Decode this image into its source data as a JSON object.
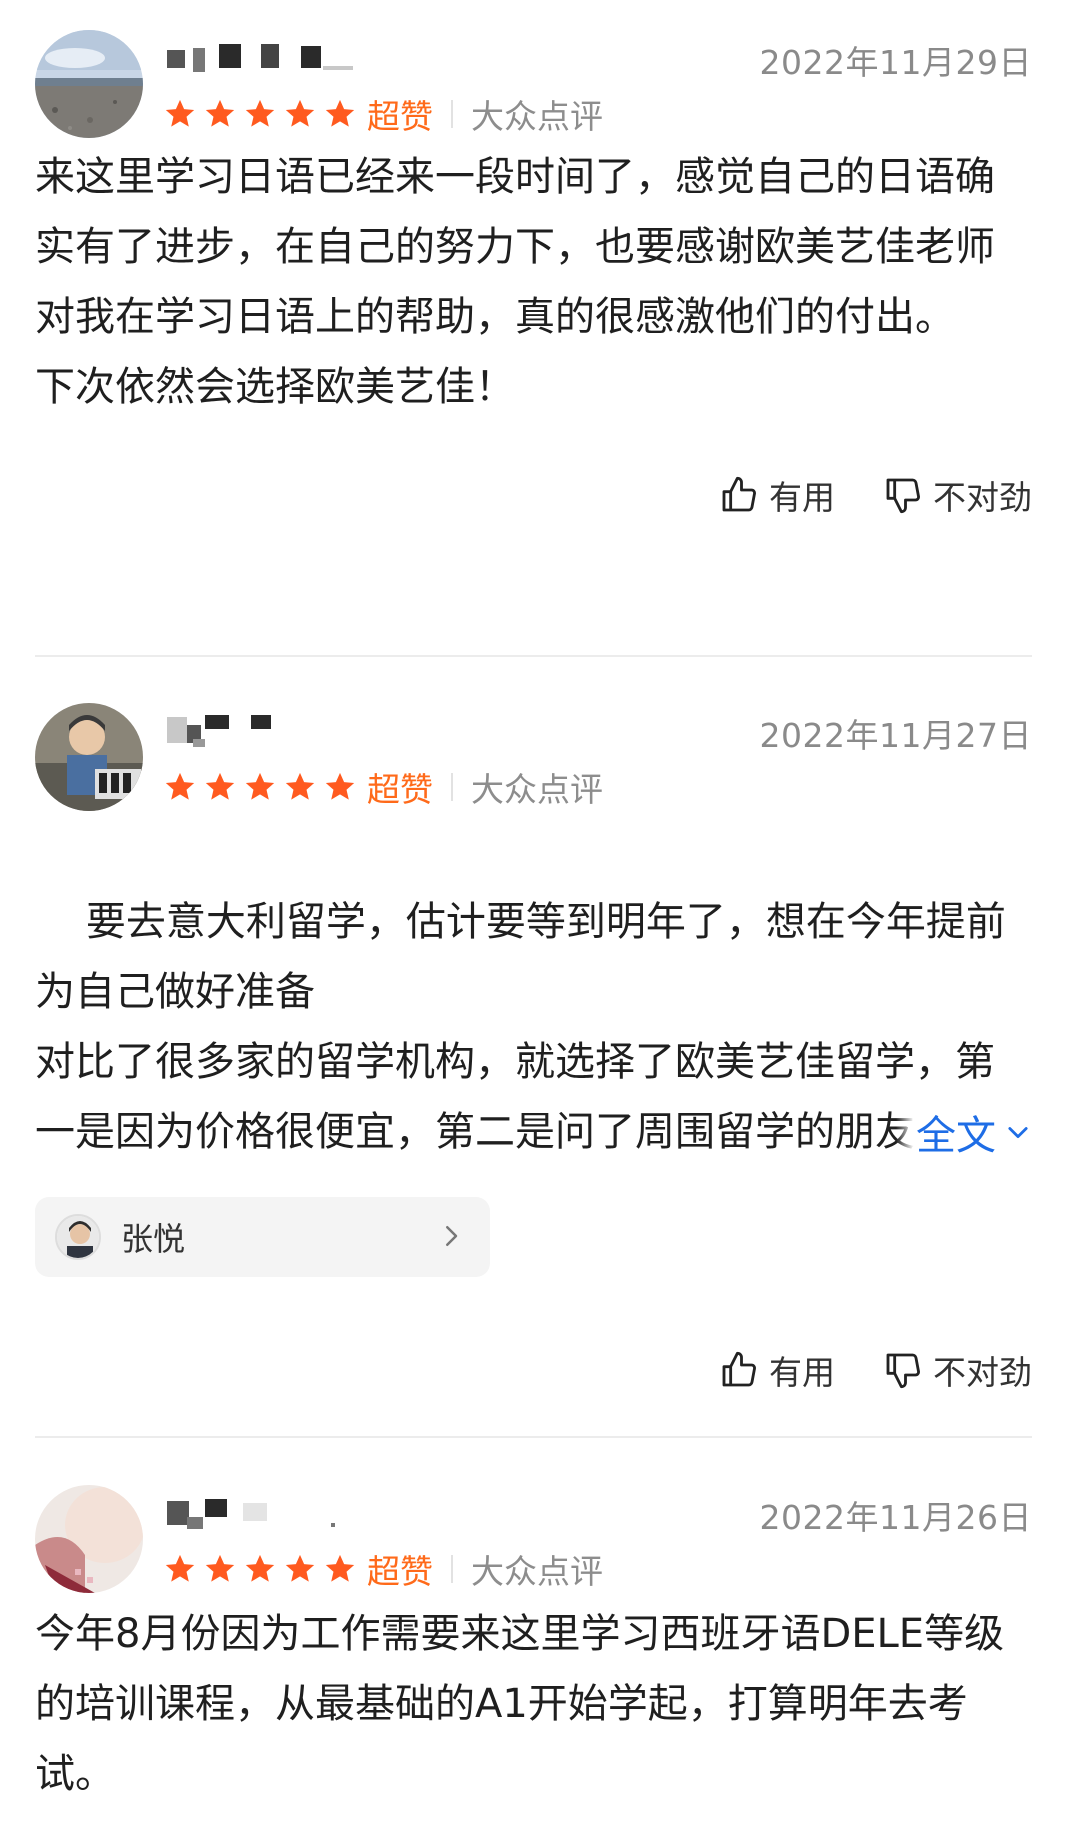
{
  "reviews": [
    {
      "date": "2022年11月29日",
      "rating": 5,
      "rating_label": "超赞",
      "source": "大众点评",
      "body": "来这里学习日语已经来一段时间了，感觉自己的日语确实有了进步，在自己的努力下，也要感谢欧美艺佳老师对我在学习日语上的帮助，真的很感激他们的付出。\n下次依然会选择欧美艺佳！",
      "useful_label": "有用",
      "wrong_label": "不对劲"
    },
    {
      "date": "2022年11月27日",
      "rating": 5,
      "rating_label": "超赞",
      "source": "大众点评",
      "body": "要去意大利留学，估计要等到明年了，想在今年提前为自己做好准备\n对比了很多家的留学机构，就选择了欧美艺佳留学，第一是因为价格很便宜，第二是问了周围留学的朋友，也知道这里，评价也不错，就抱着试一试",
      "more_label": "全文",
      "reply_name": "张悦",
      "useful_label": "有用",
      "wrong_label": "不对劲"
    },
    {
      "date": "2022年11月26日",
      "rating": 5,
      "rating_label": "超赞",
      "source": "大众点评",
      "body": "今年8月份因为工作需要来这里学习西班牙语DELE等级的培训课程，从最基础的A1开始学起，打算明年去考试。"
    }
  ],
  "colors": {
    "star": "#ff5a1f",
    "rating_label": "#ff6a1a",
    "link": "#1e6de6",
    "date": "#8a8a8a"
  },
  "icons": [
    "star-icon",
    "thumbs-up-icon",
    "thumbs-down-icon",
    "chevron-down-icon",
    "chevron-right-icon"
  ]
}
